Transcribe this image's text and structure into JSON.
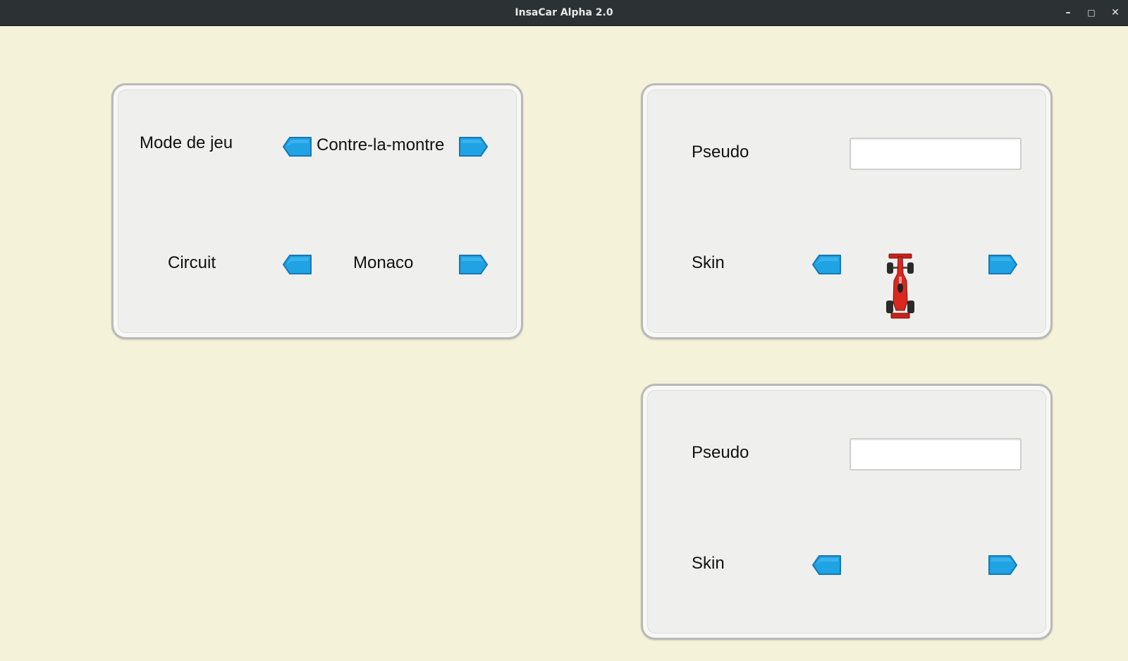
{
  "window": {
    "title": "InsaCar Alpha 2.0",
    "controls": {
      "minimize": "–",
      "maximize": "□",
      "close": "✕"
    }
  },
  "colors": {
    "background": "#f4f3da",
    "panel": "#efefed",
    "arrow": "#1fa3e5",
    "arrow_border": "#1679b3",
    "car": "#d9281f"
  },
  "game_settings": {
    "mode_label": "Mode de jeu",
    "mode_value": "Contre-la-montre",
    "circuit_label": "Circuit",
    "circuit_value": "Monaco",
    "prev_icon": "arrow-left-icon",
    "next_icon": "arrow-right-icon"
  },
  "player1": {
    "pseudo_label": "Pseudo",
    "pseudo_value": "",
    "skin_label": "Skin",
    "skin_icon": "red-race-car-icon"
  },
  "player2": {
    "pseudo_label": "Pseudo",
    "pseudo_value": "",
    "skin_label": "Skin"
  }
}
